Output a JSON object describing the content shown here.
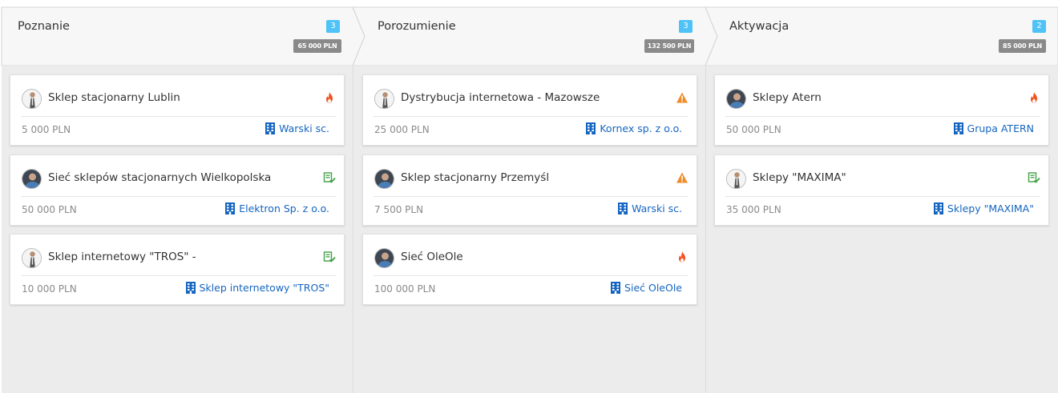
{
  "columns": [
    {
      "title": "Poznanie",
      "count": "3",
      "sum": "65 000 PLN",
      "cards": [
        {
          "title": "Sklep stacjonarny Lublin",
          "amount": "5 000 PLN",
          "company": "Warski sc.",
          "status_icon": "fire-icon",
          "avatar": "light"
        },
        {
          "title": "Sieć sklepów stacjonarnych Wielkopolska",
          "amount": "50 000 PLN",
          "company": "Elektron Sp. z o.o.",
          "status_icon": "checklist-icon",
          "avatar": "dark"
        },
        {
          "title": "Sklep internetowy \"TROS\" -",
          "amount": "10 000 PLN",
          "company": "Sklep internetowy \"TROS\"",
          "status_icon": "checklist-icon",
          "avatar": "light"
        }
      ]
    },
    {
      "title": "Porozumienie",
      "count": "3",
      "sum": "132 500 PLN",
      "cards": [
        {
          "title": "Dystrybucja internetowa - Mazowsze",
          "amount": "25 000 PLN",
          "company": "Kornex sp. z o.o.",
          "status_icon": "warning-icon",
          "avatar": "light"
        },
        {
          "title": "Sklep stacjonarny Przemyśl",
          "amount": "7 500 PLN",
          "company": "Warski sc.",
          "status_icon": "warning-icon",
          "avatar": "dark"
        },
        {
          "title": "Sieć OleOle",
          "amount": "100 000 PLN",
          "company": "Sieć OleOle",
          "status_icon": "fire-icon",
          "avatar": "dark"
        }
      ]
    },
    {
      "title": "Aktywacja",
      "count": "2",
      "sum": "85 000 PLN",
      "cards": [
        {
          "title": "Sklepy Atern",
          "amount": "50 000 PLN",
          "company": "Grupa ATERN",
          "status_icon": "fire-icon",
          "avatar": "dark"
        },
        {
          "title": "Sklepy \"MAXIMA\"",
          "amount": "35 000 PLN",
          "company": "Sklepy \"MAXIMA\"",
          "status_icon": "checklist-icon",
          "avatar": "light"
        }
      ]
    }
  ],
  "colors": {
    "count_badge": "#4fc3f7",
    "sum_badge": "#8a8a8a",
    "link": "#1565c0",
    "fire": "#f4511e",
    "warning": "#ef8c2b",
    "checklist": "#43a047"
  }
}
